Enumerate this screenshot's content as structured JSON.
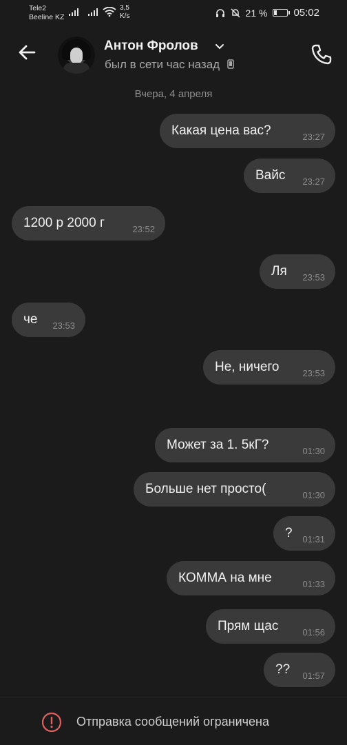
{
  "status_bar": {
    "carrier1": "Tele2",
    "carrier2": "Beeline KZ",
    "speed_value": "3,5",
    "speed_unit": "K/s",
    "battery_text": "21 %",
    "battery_level": 0.21,
    "time": "05:02"
  },
  "header": {
    "contact_name": "Антон Фролов",
    "last_seen": "был в сети час назад"
  },
  "chat": {
    "date_separator": "Вчера, 4 апреля",
    "messages": [
      {
        "side": "out",
        "text": "Какая цена вас?",
        "time": "23:27"
      },
      {
        "side": "out",
        "text": "Вайс",
        "time": "23:27"
      },
      {
        "side": "in",
        "text": "1200 р 2000 г",
        "time": "23:52"
      },
      {
        "side": "out",
        "text": "Ля",
        "time": "23:53"
      },
      {
        "side": "in",
        "text": "че",
        "time": "23:53"
      },
      {
        "side": "out",
        "text": "Не, ничего",
        "time": "23:53"
      },
      {
        "side": "out",
        "text": "Может за 1. 5кГ?",
        "time": "01:30"
      },
      {
        "side": "out",
        "text": "Больше нет просто(",
        "time": "01:30"
      },
      {
        "side": "out",
        "text": "?",
        "time": "01:31"
      },
      {
        "side": "out",
        "text": "КОММА на мне",
        "time": "01:33"
      },
      {
        "side": "out",
        "text": "Прям щас",
        "time": "01:56"
      },
      {
        "side": "out",
        "text": "??",
        "time": "01:57"
      }
    ]
  },
  "footer": {
    "restriction_text": "Отправка сообщений ограничена"
  },
  "icons": {
    "back": "arrow-left-icon",
    "call": "phone-icon",
    "device": "mobile-device-icon",
    "warning": "exclamation-circle-icon"
  }
}
